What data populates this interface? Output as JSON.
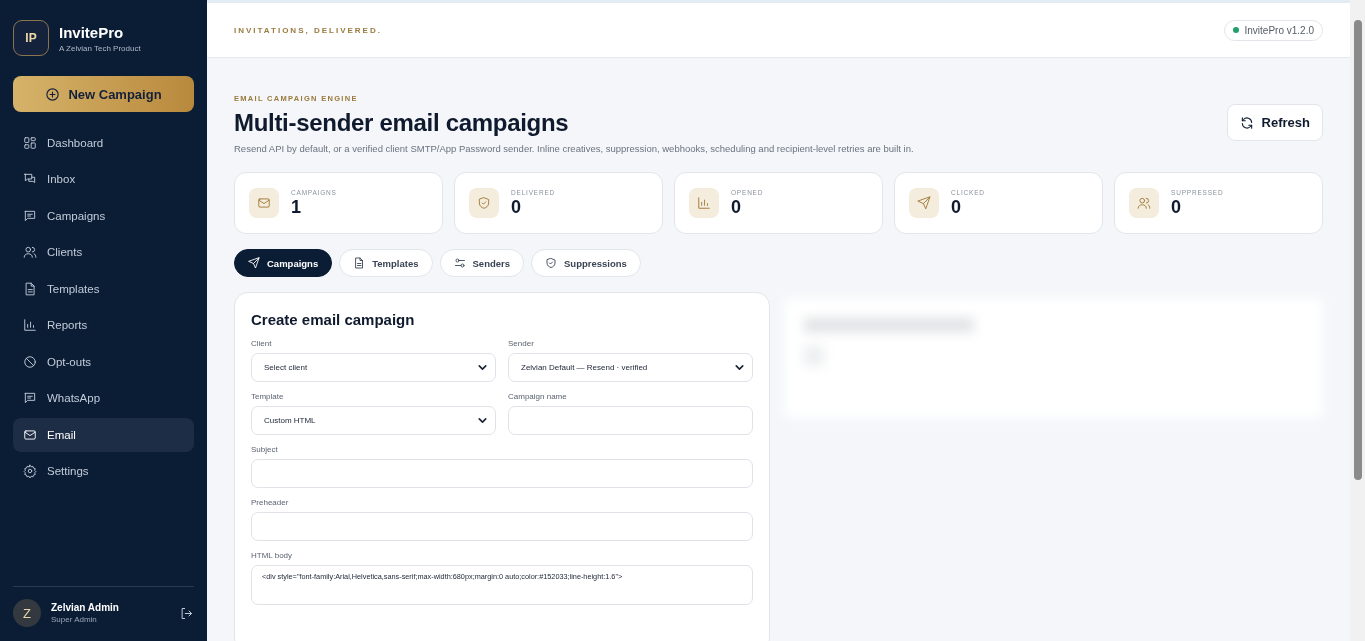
{
  "brand": {
    "logo": "IP",
    "name": "InvitePro",
    "tagline": "A Zelvian Tech Product"
  },
  "new_campaign_button": "New Campaign",
  "sidebar": {
    "items": [
      {
        "label": "Dashboard",
        "selected": false
      },
      {
        "label": "Inbox",
        "selected": false
      },
      {
        "label": "Campaigns",
        "selected": false
      },
      {
        "label": "Clients",
        "selected": false
      },
      {
        "label": "Templates",
        "selected": false
      },
      {
        "label": "Reports",
        "selected": false
      },
      {
        "label": "Opt-outs",
        "selected": false
      },
      {
        "label": "WhatsApp",
        "selected": false
      },
      {
        "label": "Email",
        "selected": true
      },
      {
        "label": "Settings",
        "selected": false
      }
    ]
  },
  "user": {
    "initial": "Z",
    "name": "Zelvian Admin",
    "role": "Super Admin"
  },
  "header": {
    "tagline": "INVITATIONS, DELIVERED.",
    "version": "InvitePro v1.2.0"
  },
  "page": {
    "eyebrow": "EMAIL CAMPAIGN ENGINE",
    "title": "Multi-sender email campaigns",
    "description": "Resend API by default, or a verified client SMTP/App Password sender. Inline creatives, suppression, webhooks, scheduling and recipient-level retries are built in.",
    "refresh_button": "Refresh"
  },
  "stats": [
    {
      "label": "CAMPAIGNS",
      "value": "1"
    },
    {
      "label": "DELIVERED",
      "value": "0"
    },
    {
      "label": "OPENED",
      "value": "0"
    },
    {
      "label": "CLICKED",
      "value": "0"
    },
    {
      "label": "SUPPRESSED",
      "value": "0"
    }
  ],
  "tabs": [
    {
      "label": "Campaigns",
      "selected": true
    },
    {
      "label": "Templates",
      "selected": false
    },
    {
      "label": "Senders",
      "selected": false
    },
    {
      "label": "Suppressions",
      "selected": false
    }
  ],
  "form": {
    "title": "Create email campaign",
    "rows": [
      [
        {
          "label": "Client",
          "kind": "select",
          "value": "Select client"
        },
        {
          "label": "Sender",
          "kind": "select",
          "value": "Zelvian Default — Resend · verified"
        }
      ],
      [
        {
          "label": "Template",
          "kind": "select",
          "value": "Custom HTML"
        },
        {
          "label": "Campaign name",
          "kind": "input"
        }
      ],
      [
        {
          "label": "Subject",
          "kind": "input"
        }
      ],
      [
        {
          "label": "Preheader",
          "kind": "input"
        }
      ],
      [
        {
          "label": "HTML body",
          "kind": "textarea",
          "value": "<div style=\"font-family:Arial,Helvetica,sans-serif;max-width:680px;margin:0 auto;color:#152033;line-height:1.6\">"
        }
      ]
    ]
  }
}
